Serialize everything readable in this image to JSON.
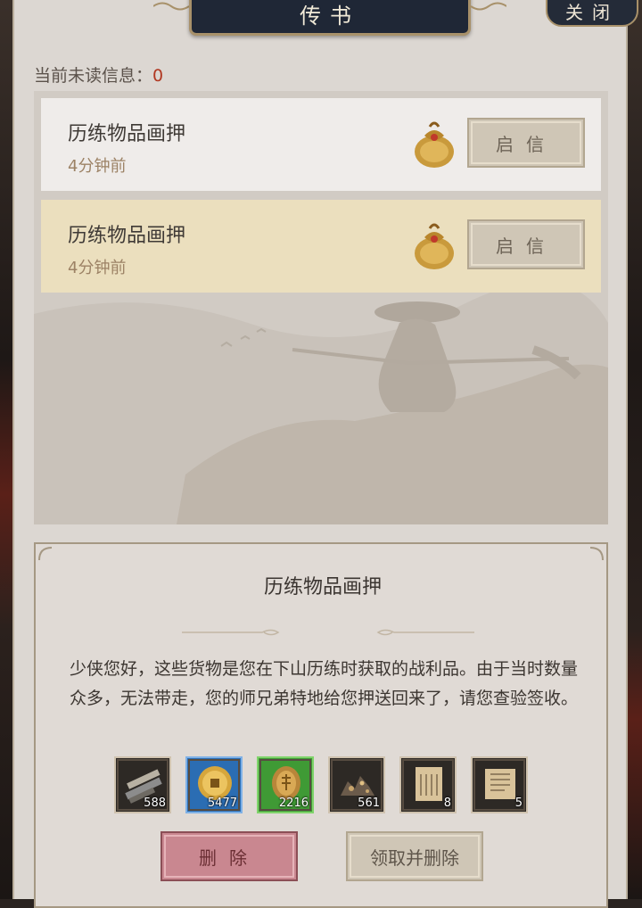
{
  "window": {
    "title": "传书",
    "close_label": "关闭"
  },
  "unread": {
    "label": "当前未读信息：",
    "count": "0"
  },
  "mails": [
    {
      "title": "历练物品画押",
      "time": "4分钟前",
      "open_label": "启信",
      "icon": "money-bag-icon"
    },
    {
      "title": "历练物品画押",
      "time": "4分钟前",
      "open_label": "启信",
      "icon": "money-bag-icon"
    }
  ],
  "detail": {
    "title": "历练物品画押",
    "body": "少侠您好，这些货物是您在下山历练时获取的战利品。由于当时数量众多，无法带走，您的师兄弟特地给您押送回来了，请您查验签收。",
    "items": [
      {
        "icon": "wood-planks-icon",
        "count": "588",
        "quality": "normal"
      },
      {
        "icon": "gold-coin-icon",
        "count": "5477",
        "quality": "blue"
      },
      {
        "icon": "copper-token-icon",
        "count": "2216",
        "quality": "green"
      },
      {
        "icon": "ore-pile-icon",
        "count": "561",
        "quality": "normal"
      },
      {
        "icon": "scroll-document-icon",
        "count": "8",
        "quality": "normal"
      },
      {
        "icon": "scroll-document-icon",
        "count": "5",
        "quality": "normal"
      }
    ],
    "delete_label": "删除",
    "take_delete_label": "领取并删除"
  },
  "colors": {
    "unread_count": "#b13822",
    "title_plate": "#1f2736",
    "delete_button": "#c98790"
  }
}
